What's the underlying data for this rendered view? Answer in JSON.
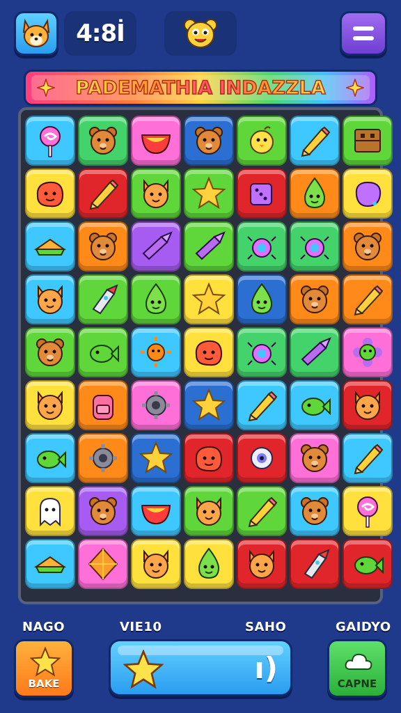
{
  "header": {
    "score": "4:8İ",
    "avatar_icon": "fox-avatar-icon",
    "mascot_icon": "bear-mascot-icon",
    "menu_icon": "hamburger-menu-icon"
  },
  "title": "PADEMATHIA INDAZZLA",
  "board": {
    "rows": 9,
    "cols": 7,
    "tiles": [
      [
        "lollipop",
        "bear-face",
        "bowl",
        "bear-face",
        "chick",
        "pencil",
        "crate"
      ],
      [
        "blob-face",
        "pencil",
        "cat-face",
        "star",
        "dice",
        "drop-face",
        "balloon"
      ],
      [
        "sandwich",
        "bear-face",
        "crayon",
        "crayon",
        "bug",
        "bug",
        "bear-face"
      ],
      [
        "cat-face",
        "rocket",
        "drop-face",
        "star",
        "drop-face",
        "bear-face",
        "pencil"
      ],
      [
        "bear-face",
        "fish",
        "sun-face",
        "blob-face",
        "bug",
        "crayon",
        "flower-face"
      ],
      [
        "cat-face",
        "backpack",
        "gear",
        "star",
        "pencil",
        "fish",
        "cat-face"
      ],
      [
        "fish",
        "gear",
        "star",
        "blob-face",
        "eyeball",
        "bear-face",
        "pencil"
      ],
      [
        "ghost",
        "bear-face",
        "bowl",
        "cat-face",
        "pencil",
        "bear-face",
        "lollipop"
      ],
      [
        "sandwich",
        "diamond",
        "cat-face",
        "drop-face",
        "cat-face",
        "rocket",
        "fish"
      ]
    ],
    "colors": [
      [
        "#3fc8ff",
        "#44d36a",
        "#ff6fd8",
        "#2a6fd1",
        "#5fd63a",
        "#3fc8ff",
        "#5fd63a"
      ],
      [
        "#ffe03d",
        "#e0262b",
        "#5fd63a",
        "#5fd63a",
        "#e0262b",
        "#ff8a1a",
        "#ffe03d"
      ],
      [
        "#3fc8ff",
        "#ff8a1a",
        "#a65cf0",
        "#5fd63a",
        "#44d36a",
        "#44d36a",
        "#ff8a1a"
      ],
      [
        "#3fc8ff",
        "#5fd63a",
        "#5fd63a",
        "#ffe03d",
        "#2a6fd1",
        "#ff8a1a",
        "#ff8a1a"
      ],
      [
        "#5fd63a",
        "#5fd63a",
        "#3fc8ff",
        "#ffe03d",
        "#44d36a",
        "#44d36a",
        "#ff6fd8"
      ],
      [
        "#ffe03d",
        "#ff8a1a",
        "#ff6fd8",
        "#2a6fd1",
        "#3fc8ff",
        "#3fc8ff",
        "#e0262b"
      ],
      [
        "#3fc8ff",
        "#ff8a1a",
        "#2a6fd1",
        "#e0262b",
        "#e0262b",
        "#ff6fd8",
        "#3fc8ff"
      ],
      [
        "#ffe03d",
        "#a65cf0",
        "#3fc8ff",
        "#5fd63a",
        "#5fd63a",
        "#3fc8ff",
        "#ffe03d"
      ],
      [
        "#3fc8ff",
        "#ff6fd8",
        "#ffe03d",
        "#ffe03d",
        "#e0262b",
        "#e0262b",
        "#e0262b"
      ]
    ]
  },
  "bottom": {
    "label_left": "NAGO",
    "label_mid": "VIE10",
    "label_mid2": "SAHO",
    "label_right": "GAIDYO",
    "bake_label": "BAKE",
    "caper_label": "CAPNE",
    "progress_glyph": "ı)",
    "bake_icon": "star-icon",
    "caper_icon": "cloud-icon",
    "progress_icon": "star-icon"
  }
}
